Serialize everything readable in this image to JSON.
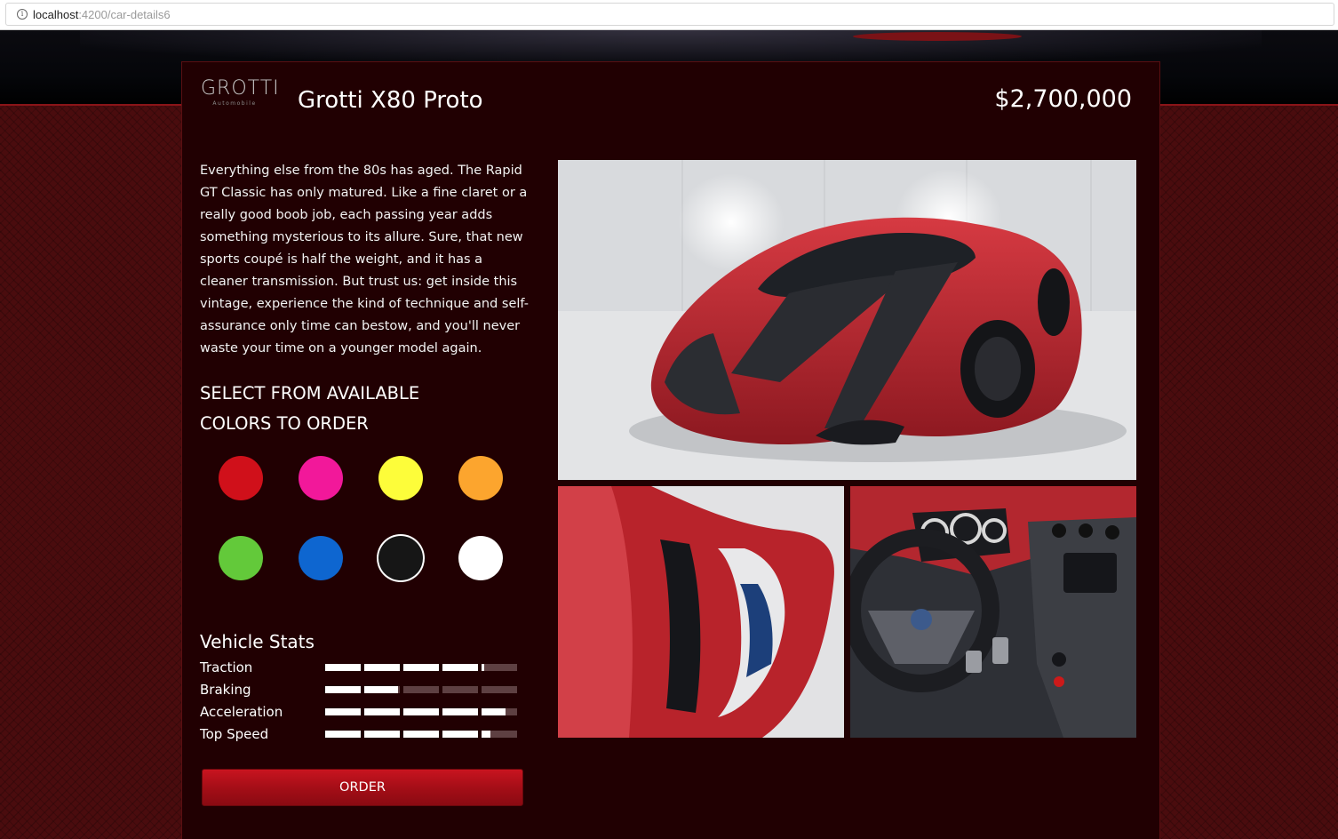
{
  "browser": {
    "url_host": "localhost",
    "url_rest": ":4200/car-details6",
    "info_icon": "info-icon"
  },
  "brand": {
    "name": "GROTTI",
    "subtitle": "Automobile"
  },
  "car": {
    "title": "Grotti X80 Proto",
    "price": "$2,700,000",
    "description": "Everything else from the 80s has aged. The Rapid GT Classic has only matured. Like a fine claret or a really good boob job, each passing year adds something mysterious to its allure. Sure, that new sports coupé is half the weight, and it has a cleaner transmission. But trust us: get inside this vintage, experience the kind of technique and self-assurance only time can bestow, and you'll never waste your time on a younger model again."
  },
  "colors": {
    "heading": "SELECT FROM AVAILABLE COLORS TO ORDER",
    "swatches": [
      {
        "name": "red",
        "hex": "#d0101a"
      },
      {
        "name": "pink",
        "hex": "#f2189a"
      },
      {
        "name": "yellow",
        "hex": "#fdfd3a"
      },
      {
        "name": "orange",
        "hex": "#fca52e"
      },
      {
        "name": "green",
        "hex": "#63c93a"
      },
      {
        "name": "blue",
        "hex": "#0e66d0"
      },
      {
        "name": "black",
        "hex": "#161616",
        "selected": true
      },
      {
        "name": "white",
        "hex": "#ffffff"
      }
    ]
  },
  "stats": {
    "heading": "Vehicle Stats",
    "items": [
      {
        "label": "Traction",
        "value": 0.83
      },
      {
        "label": "Braking",
        "value": 0.38
      },
      {
        "label": "Acceleration",
        "value": 0.94
      },
      {
        "label": "Top Speed",
        "value": 0.86
      }
    ]
  },
  "order": {
    "label": "ORDER"
  },
  "theme": {
    "accent": "#b0111b",
    "card_bg": "#210002",
    "page_bg": "#4a0c0e"
  }
}
